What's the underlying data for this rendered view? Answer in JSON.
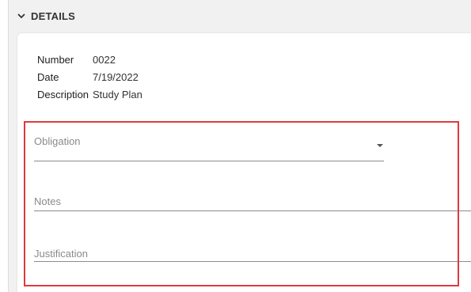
{
  "panel": {
    "title": "DETAILS",
    "toggle_icon": "chevron-down-icon"
  },
  "details": {
    "rows": [
      {
        "label": "Number",
        "value": "0022"
      },
      {
        "label": "Date",
        "value": "7/19/2022"
      },
      {
        "label": "Description",
        "value": "Study Plan"
      }
    ]
  },
  "fields": {
    "obligation": {
      "placeholder": "Obligation",
      "value": ""
    },
    "notes": {
      "placeholder": "Notes",
      "value": ""
    },
    "justification": {
      "placeholder": "Justification",
      "value": ""
    }
  },
  "colors": {
    "highlight": "#e0393e",
    "background": "#f1f1f1",
    "card": "#ffffff"
  }
}
